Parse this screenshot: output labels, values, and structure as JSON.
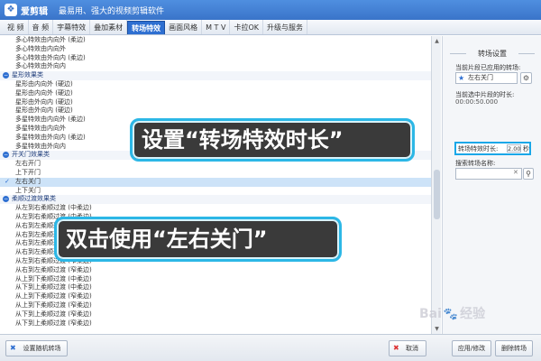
{
  "titlebar": {
    "app_name": "爱剪辑",
    "slogan": "最易用、强大的视频剪辑软件"
  },
  "tabs": [
    {
      "label": "视 频"
    },
    {
      "label": "音 频"
    },
    {
      "label": "字幕特效"
    },
    {
      "label": "叠加素材"
    },
    {
      "label": "转场特效",
      "active": true
    },
    {
      "label": "画面风格"
    },
    {
      "label": "M T V"
    },
    {
      "label": "卡拉OK"
    },
    {
      "label": "升级与服务"
    }
  ],
  "list": [
    {
      "type": "item",
      "text": "多心特效由内向外 (柔边)"
    },
    {
      "type": "item",
      "text": "多心特效由内向外"
    },
    {
      "type": "item",
      "text": "多心特效由外向内 (柔边)"
    },
    {
      "type": "item",
      "text": "多心特效由外向内"
    },
    {
      "type": "group",
      "text": "星形效果类"
    },
    {
      "type": "item",
      "text": "星形由内向外 (硬边)"
    },
    {
      "type": "item",
      "text": "星形由内向外 (硬边)"
    },
    {
      "type": "item",
      "text": "星形由外向内 (硬边)"
    },
    {
      "type": "item",
      "text": "星形由外向内 (硬边)"
    },
    {
      "type": "item",
      "text": "多星特效由内向外 (柔边)"
    },
    {
      "type": "item",
      "text": "多星特效由内向外"
    },
    {
      "type": "item",
      "text": "多星特效由外向内 (柔边)"
    },
    {
      "type": "item",
      "text": "多星特效由外向内"
    },
    {
      "type": "group",
      "text": "开关门效果类"
    },
    {
      "type": "item",
      "text": "左右开门"
    },
    {
      "type": "item",
      "text": "上下开门"
    },
    {
      "type": "item",
      "text": "左右关门",
      "selected": true
    },
    {
      "type": "item",
      "text": "上下关门"
    },
    {
      "type": "group",
      "text": "柔顺过渡效果类"
    },
    {
      "type": "item",
      "text": "从左到右柔顺过渡 (中柔边)"
    },
    {
      "type": "item",
      "text": "从左到右柔顺过渡 (中柔边)"
    },
    {
      "type": "item",
      "text": "从右到左柔顺过渡 (中柔边)"
    },
    {
      "type": "item",
      "text": "从右到左柔顺过渡 (中柔边)"
    },
    {
      "type": "item",
      "text": "从右到左柔顺过渡 (中柔边)"
    },
    {
      "type": "item",
      "text": "从右到左柔顺过渡 (中柔边)"
    },
    {
      "type": "item",
      "text": "从左到右柔顺过渡 (窄柔边)"
    },
    {
      "type": "item",
      "text": "从右到左柔顺过渡 (窄柔边)"
    },
    {
      "type": "item",
      "text": "从上到下柔顺过渡 (中柔边)"
    },
    {
      "type": "item",
      "text": "从下到上柔顺过渡 (中柔边)"
    },
    {
      "type": "item",
      "text": "从上到下柔顺过渡 (窄柔边)"
    },
    {
      "type": "item",
      "text": "从上到下柔顺过渡 (窄柔边)"
    },
    {
      "type": "item",
      "text": "从下到上柔顺过渡 (窄柔边)"
    },
    {
      "type": "item",
      "text": "从下到上柔顺过渡 (窄柔边)"
    }
  ],
  "panel": {
    "title": "转场设置",
    "applied_label": "当前片段已应用的转场:",
    "applied_value": "左右关门",
    "selected_duration_label": "当前选中片段的时长:",
    "selected_duration_value": "00:00:50.000",
    "duration_label": "转场特效时长:",
    "duration_value": "2.00",
    "duration_unit": "秒",
    "search_label": "搜索转场名称:",
    "search_placeholder": ""
  },
  "bottom": {
    "random_label": "设置随机转场",
    "cancel_label": "取消",
    "apply_label": "应用/修改",
    "delete_label": "删除转场"
  },
  "callouts": {
    "set_duration": "设置“转场特效时长”",
    "double_click": "双击使用“左右关门”"
  },
  "watermark": {
    "left": "Bai",
    "right": "经验"
  },
  "colors": {
    "accent": "#2e6fd1",
    "callout_border": "#2cb7e6",
    "callout_bg": "#3a3a3a"
  }
}
